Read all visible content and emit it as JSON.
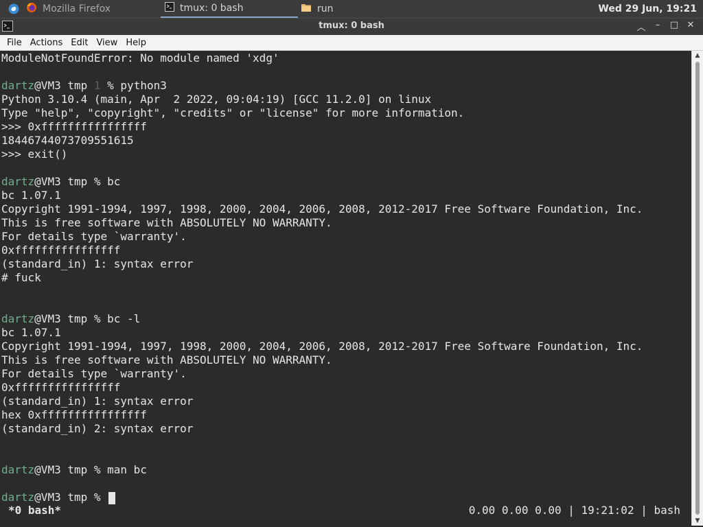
{
  "taskbar": {
    "firefox_label": "Mozilla Firefox",
    "tmux_label": "tmux: 0 bash",
    "run_label": "run",
    "clock": "Wed 29 Jun, 19:21"
  },
  "window": {
    "title": "tmux: 0 bash",
    "minimize": "–",
    "maximize": "□",
    "close": "✕"
  },
  "menu": [
    "File",
    "Actions",
    "Edit",
    "View",
    "Help"
  ],
  "prompt": {
    "user": "dartz",
    "host_dir": "@VM3 tmp ",
    "status": "1",
    "symbol": "% "
  },
  "terminal": {
    "l0": "ModuleNotFoundError: No module named 'xdg'",
    "cmd_python": "python3",
    "l3": "Python 3.10.4 (main, Apr  2 2022, 09:04:19) [GCC 11.2.0] on linux",
    "l4": "Type \"help\", \"copyright\", \"credits\" or \"license\" for more information.",
    "l5": ">>> 0xffffffffffffffff",
    "l6": "18446744073709551615",
    "l7": ">>> exit()",
    "cmd_bc": "bc",
    "l10": "bc 1.07.1",
    "l11": "Copyright 1991-1994, 1997, 1998, 2000, 2004, 2006, 2008, 2012-2017 Free Software Foundation, Inc.",
    "l12": "This is free software with ABSOLUTELY NO WARRANTY.",
    "l13": "For details type `warranty'.",
    "l14": "0xffffffffffffffff",
    "l15": "(standard_in) 1: syntax error",
    "l16": "# fuck",
    "cmd_bcl": "bc -l",
    "l20": "bc 1.07.1",
    "l21": "Copyright 1991-1994, 1997, 1998, 2000, 2004, 2006, 2008, 2012-2017 Free Software Foundation, Inc.",
    "l22": "This is free software with ABSOLUTELY NO WARRANTY.",
    "l23": "For details type `warranty'.",
    "l24": "0xffffffffffffffff",
    "l25": "(standard_in) 1: syntax error",
    "l26": "hex 0xffffffffffffffff",
    "l27": "(standard_in) 2: syntax error",
    "cmd_man": "man bc"
  },
  "tmux_status": {
    "left": "*0 bash*",
    "right": "0.00 0.00 0.00 | 19:21:02 | bash"
  },
  "colors": {
    "terminal_bg": "#2b2b2b",
    "terminal_fg": "#e6e6e6",
    "prompt_user": "#6fb08a"
  }
}
